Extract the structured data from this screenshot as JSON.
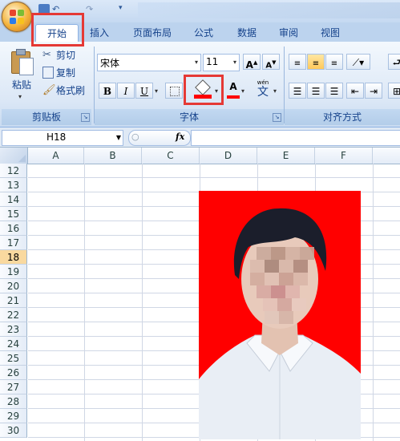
{
  "ribbon_tabs": [
    "开始",
    "插入",
    "页面布局",
    "公式",
    "数据",
    "审阅",
    "视图"
  ],
  "clipboard": {
    "paste": "粘贴",
    "cut": "剪切",
    "copy": "复制",
    "format_painter": "格式刷",
    "group_label": "剪贴板"
  },
  "font": {
    "name": "宋体",
    "size": "11",
    "bold": "B",
    "italic": "I",
    "underline": "U",
    "font_color_letter": "A",
    "phonetic_top": "wén",
    "phonetic_char": "文",
    "group_label": "字体",
    "grow_label": "A",
    "shrink_label": "A"
  },
  "alignment": {
    "group_label": "对齐方式"
  },
  "formula_bar": {
    "cell_ref": "H18",
    "fx": "fx",
    "value": ""
  },
  "columns": [
    "A",
    "B",
    "C",
    "D",
    "E",
    "F"
  ],
  "rows": [
    "12",
    "13",
    "14",
    "15",
    "16",
    "17",
    "18",
    "19",
    "20",
    "21",
    "22",
    "23",
    "24",
    "25",
    "26",
    "27",
    "28",
    "29",
    "30"
  ],
  "selected_row": "18",
  "colors": {
    "fill_color": "#ff0000",
    "font_color": "#ff0000",
    "highlight_box": "#e53935",
    "photo_background": "#ff0000"
  },
  "photo": {
    "description_icon": "portrait-photo"
  }
}
